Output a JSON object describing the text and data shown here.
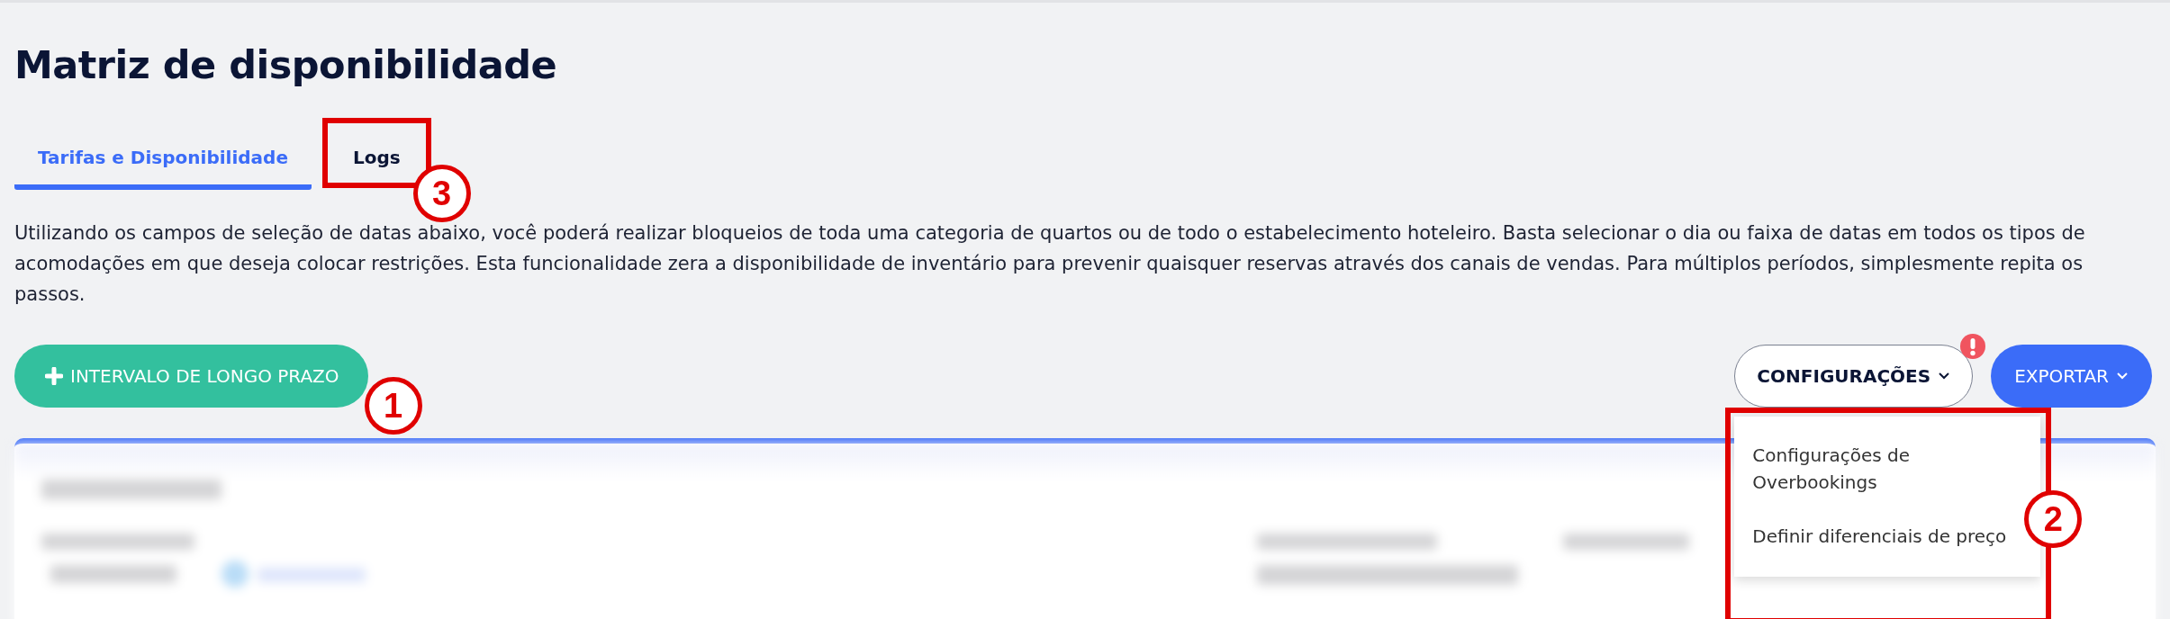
{
  "page": {
    "title": "Matriz de disponibilidade"
  },
  "tabs": [
    {
      "label": "Tarifas e Disponibilidade",
      "selected": true
    },
    {
      "label": "Logs",
      "selected": false,
      "annotation": "3"
    }
  ],
  "description": "Utilizando os campos de seleção de datas abaixo, você poderá realizar bloqueios de toda uma categoria de quartos ou de todo o estabelecimento hoteleiro. Basta selecionar o dia ou faixa de datas em todos os tipos de acomodações em que deseja colocar restrições. Esta funcionalidade zera a disponibilidade de inventário para prevenir quaisquer reservas através dos canais de vendas. Para múltiplos períodos, simplesmente repita os passos.",
  "toolbar": {
    "add_button": "INTERVALO DE LONGO PRAZO",
    "add_annotation": "1",
    "settings_button": {
      "label": "CONFIGURAÇÕES",
      "alert": true
    },
    "export_button": "EXPORTAR"
  },
  "settings_menu": {
    "expanded": true,
    "annotation": "2",
    "items": [
      "Configurações de Overbookings",
      "Definir diferenciais de preço"
    ]
  }
}
